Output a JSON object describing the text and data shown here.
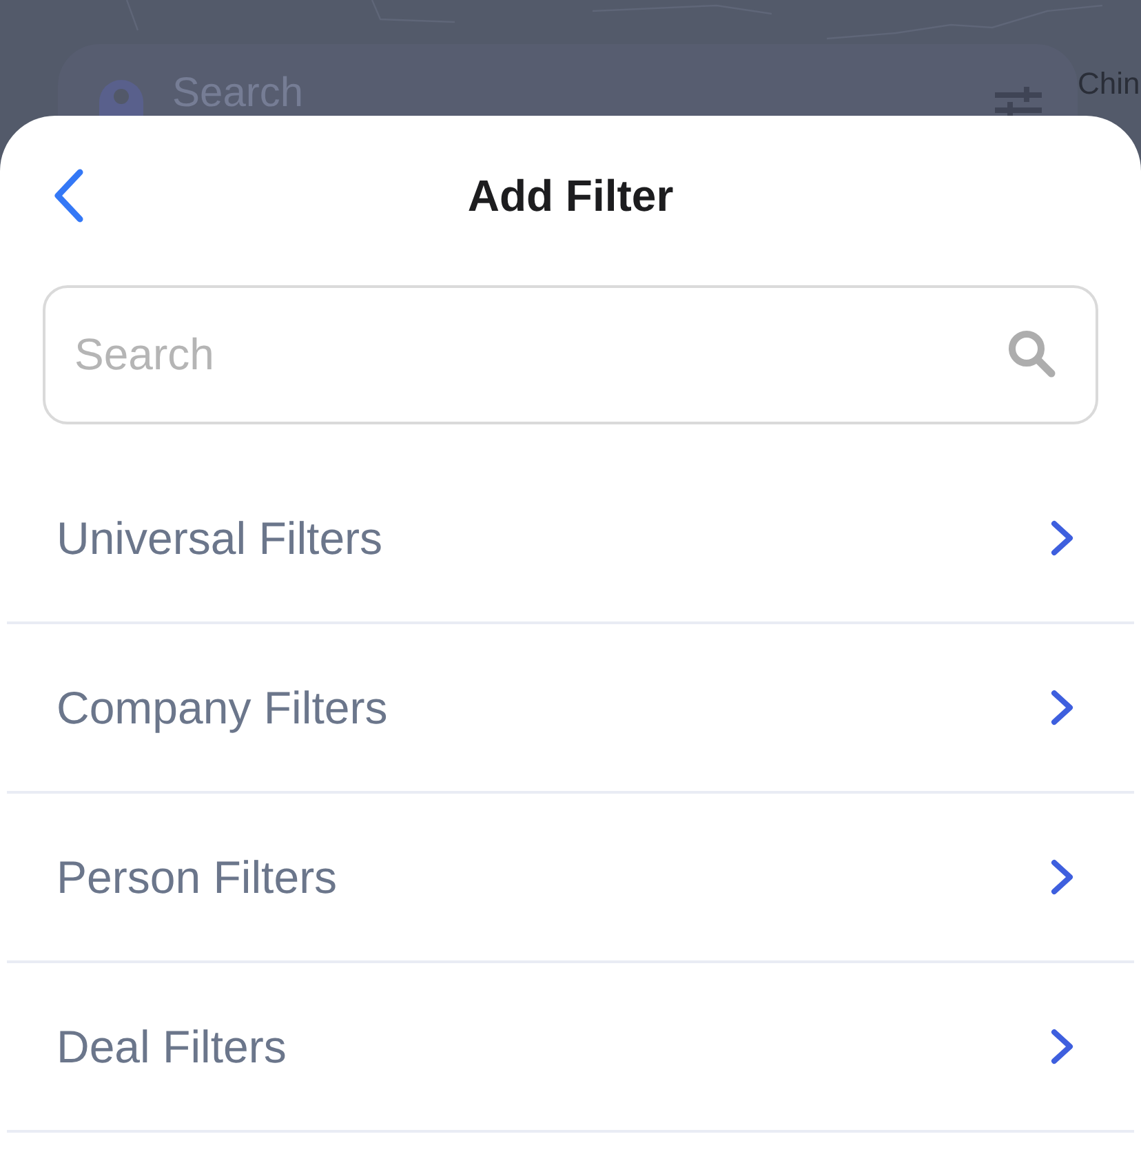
{
  "background": {
    "search": {
      "placeholder": "Search"
    },
    "map_label": "Chin"
  },
  "sheet": {
    "title": "Add Filter",
    "search": {
      "placeholder": "Search"
    },
    "items": [
      {
        "label": "Universal Filters"
      },
      {
        "label": "Company Filters"
      },
      {
        "label": "Person Filters"
      },
      {
        "label": "Deal Filters"
      }
    ]
  }
}
